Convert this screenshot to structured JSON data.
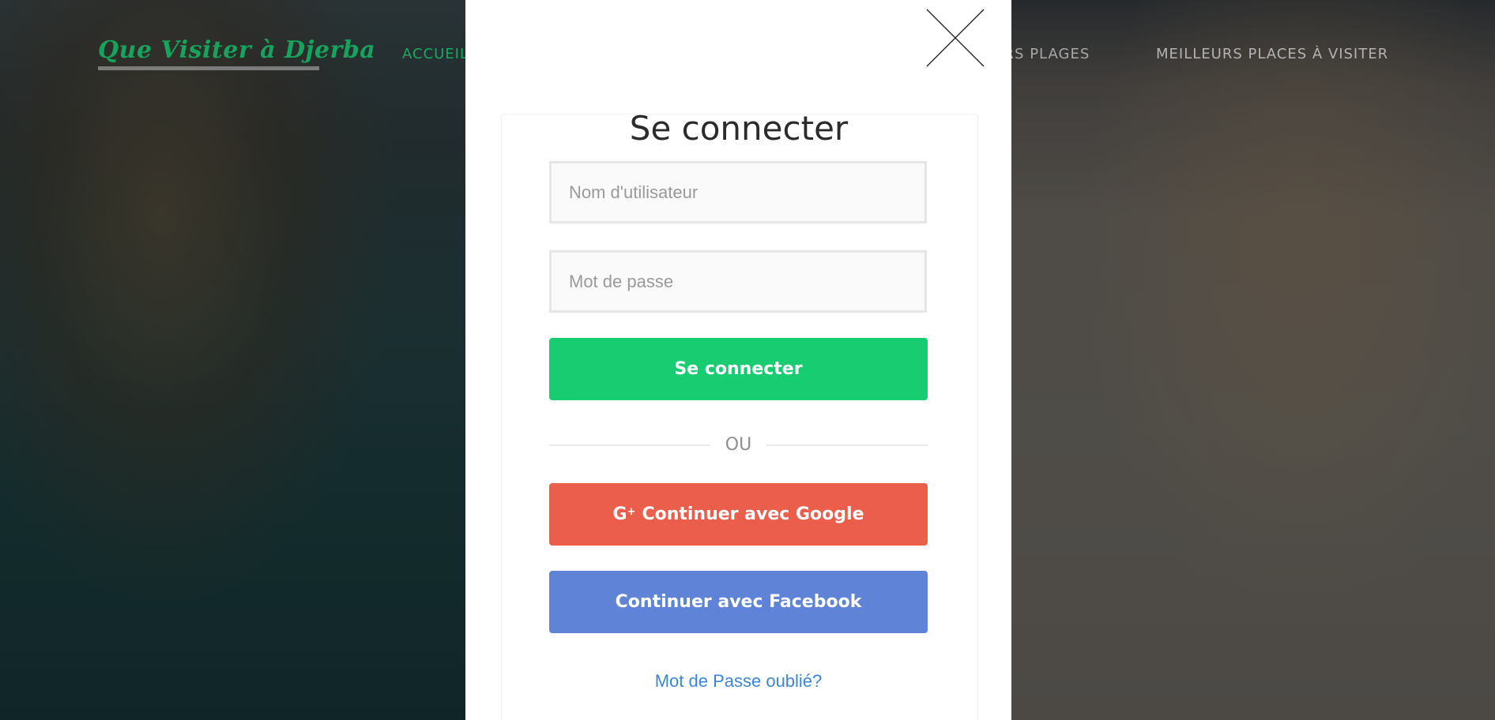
{
  "header": {
    "brand": "Que Visiter à Djerba",
    "nav": {
      "accueil": "Accueil",
      "meilleurs_plages": "eurs Plages",
      "meilleurs_places": "Meilleurs Places à Visiter"
    }
  },
  "modal": {
    "title": "Se connecter",
    "username_placeholder": "Nom d'utilisateur",
    "password_placeholder": "Mot de passe",
    "login_button": "Se connecter",
    "divider_text": "OU",
    "google_icon_text": "G",
    "google_button": "Continuer avec Google",
    "facebook_button": "Continuer avec Facebook",
    "forgot_link": "Mot de Passe oublié?"
  },
  "colors": {
    "brand_green": "#16a35c",
    "login_button": "#18cd71",
    "google_button": "#eb5e4b",
    "facebook_button": "#5f83d6",
    "link_blue": "#3d86d6"
  },
  "icons": {
    "close": "close-icon",
    "google_plus": "google-plus-icon"
  }
}
